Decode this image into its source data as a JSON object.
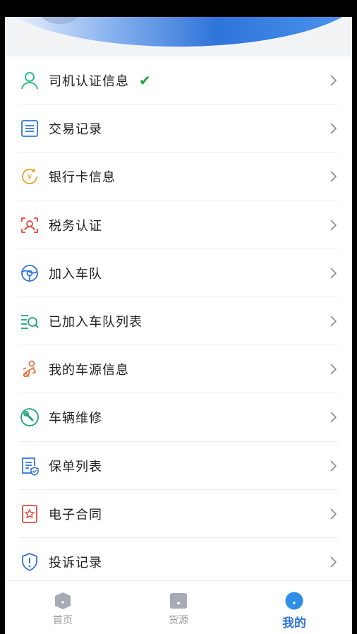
{
  "colors": {
    "accent": "#2f74d9",
    "check": "#1aa33c",
    "inactive": "#9a9a9a"
  },
  "menu": {
    "items": [
      {
        "label": "司机认证信息",
        "icon": "user-icon",
        "verified": "✔"
      },
      {
        "label": "交易记录",
        "icon": "document-list-icon"
      },
      {
        "label": "银行卡信息",
        "icon": "yuan-coin-icon"
      },
      {
        "label": "税务认证",
        "icon": "face-scan-icon"
      },
      {
        "label": "加入车队",
        "icon": "steering-wheel-icon"
      },
      {
        "label": "已加入车队列表",
        "icon": "list-search-icon"
      },
      {
        "label": "我的车源信息",
        "icon": "driver-person-icon"
      },
      {
        "label": "车辆维修",
        "icon": "wrench-icon"
      },
      {
        "label": "保单列表",
        "icon": "policy-shield-doc-icon"
      },
      {
        "label": "电子合同",
        "icon": "contract-seal-icon"
      },
      {
        "label": "投诉记录",
        "icon": "complaint-shield-icon"
      }
    ]
  },
  "tabbar": {
    "tabs": [
      {
        "label": "首页",
        "icon": "home-icon",
        "active": false
      },
      {
        "label": "货源",
        "icon": "cargo-icon",
        "active": false
      },
      {
        "label": "我的",
        "icon": "profile-icon",
        "active": true
      }
    ]
  }
}
